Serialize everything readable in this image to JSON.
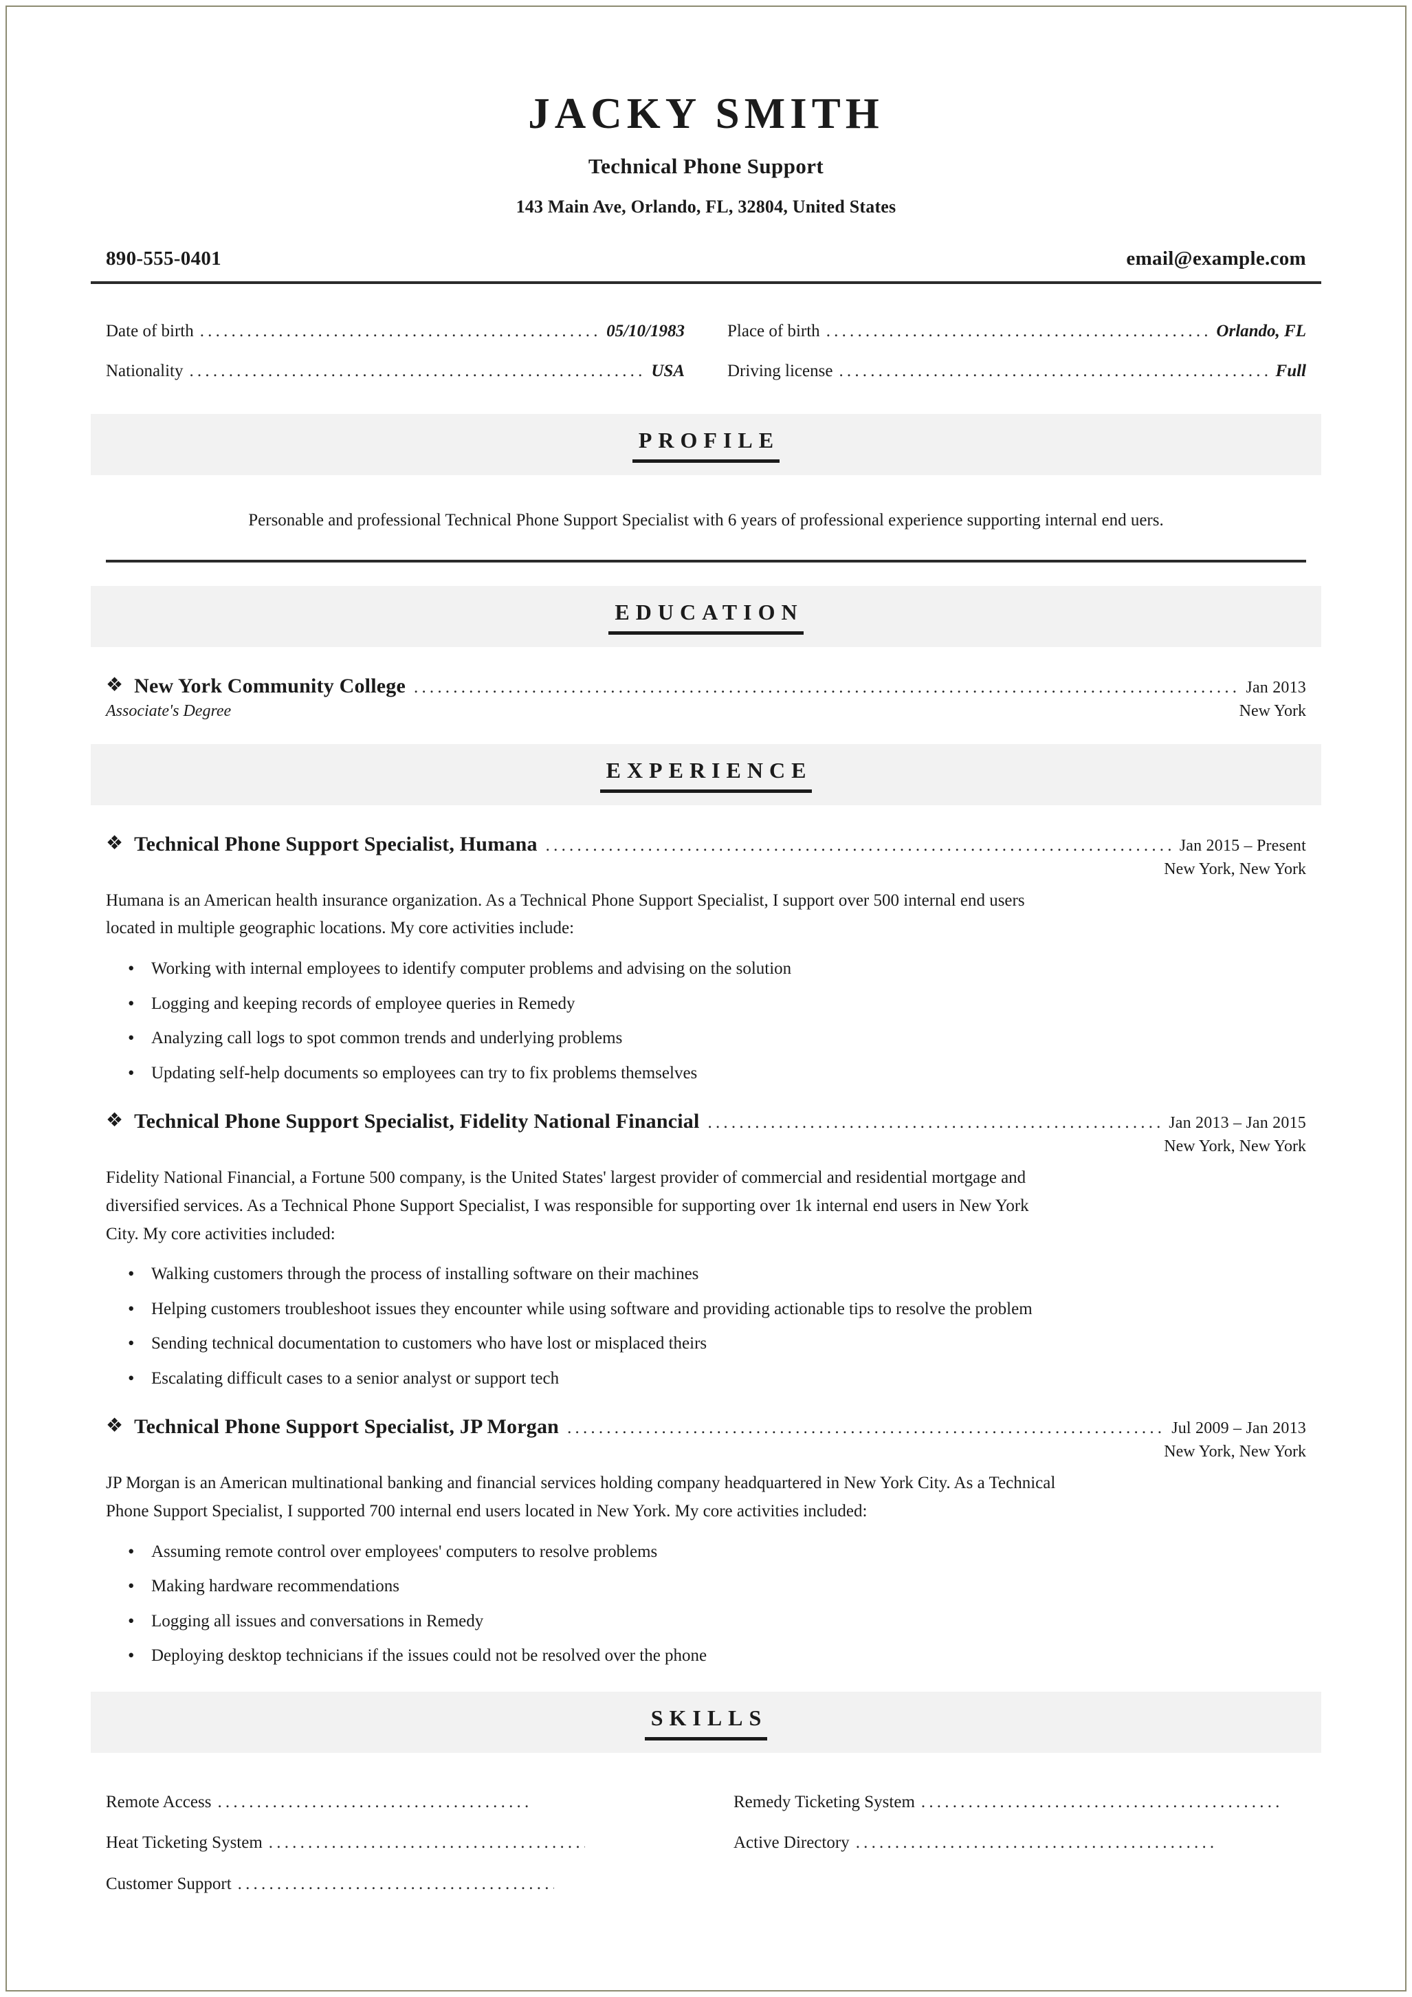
{
  "header": {
    "name": "JACKY SMITH",
    "job_title": "Technical Phone Support",
    "address": "143 Main Ave, Orlando, FL, 32804, United States",
    "phone": "890-555-0401",
    "email": "email@example.com"
  },
  "details": [
    {
      "label": "Date of birth",
      "value": "05/10/1983"
    },
    {
      "label": "Place of birth",
      "value": "Orlando, FL"
    },
    {
      "label": "Nationality",
      "value": "USA"
    },
    {
      "label": "Driving license",
      "value": "Full"
    }
  ],
  "sections": {
    "profile": "PROFILE",
    "education": "EDUCATION",
    "experience": "EXPERIENCE",
    "skills": "SKILLS"
  },
  "profile": {
    "text": "Personable and professional Technical Phone Support Specialist with 6 years of professional experience supporting internal end uers."
  },
  "education": [
    {
      "institution": "New York Community College",
      "date": "Jan 2013",
      "degree": "Associate's Degree",
      "location": "New York"
    }
  ],
  "experience": [
    {
      "title": "Technical Phone Support Specialist, Humana",
      "date": "Jan 2015 – Present",
      "location": "New York, New York",
      "description": "Humana is an American health insurance organization. As a Technical Phone Support Specialist, I support over 500 internal end users located in multiple geographic locations. My core activities include:",
      "bullets": [
        "Working with internal employees to identify computer problems and advising on the solution",
        "Logging and keeping records of employee queries in Remedy",
        "Analyzing call logs to spot common trends and underlying problems",
        "Updating self-help documents so employees can try to fix problems themselves"
      ]
    },
    {
      "title": "Technical Phone Support Specialist, Fidelity National Financial",
      "date": "Jan 2013 – Jan 2015",
      "location": "New York, New York",
      "description": "Fidelity National Financial, a Fortune 500 company, is the United States' largest provider of commercial and residential mortgage and diversified services. As a Technical Phone Support Specialist, I was responsible for supporting over 1k internal end users in New York City. My core activities included:",
      "bullets": [
        "Walking customers through the process of installing software on their machines",
        "Helping customers troubleshoot issues they encounter while using software and providing actionable tips to resolve the problem",
        "Sending technical documentation to customers who have lost or misplaced theirs",
        "Escalating difficult cases to a senior analyst or support tech"
      ]
    },
    {
      "title": "Technical Phone Support Specialist, JP Morgan",
      "date": "Jul 2009 – Jan 2013",
      "location": "New York, New York",
      "description": "JP Morgan is an American multinational banking and financial services holding company headquartered in New York City. As a Technical Phone Support Specialist, I supported 700 internal end users located in New York. My core activities included:",
      "bullets": [
        "Assuming remote control over employees' computers to resolve problems",
        "Making hardware recommendations",
        "Logging all issues and conversations in Remedy",
        "Deploying desktop technicians if the issues could not be resolved over the phone"
      ]
    }
  ],
  "skills": {
    "left": [
      "Remote Access",
      "Heat Ticketing System",
      "Customer Support"
    ],
    "right": [
      "Remedy Ticketing System",
      "Active Directory"
    ]
  },
  "glyphs": {
    "diamond_bullet": "❖",
    "dots": "...................................................................................................................................................."
  },
  "colors": {
    "page_border": "#8d8c72",
    "band_background": "#f2f2f2",
    "rule": "#2b2b2b",
    "text": "#1b1b1b"
  }
}
